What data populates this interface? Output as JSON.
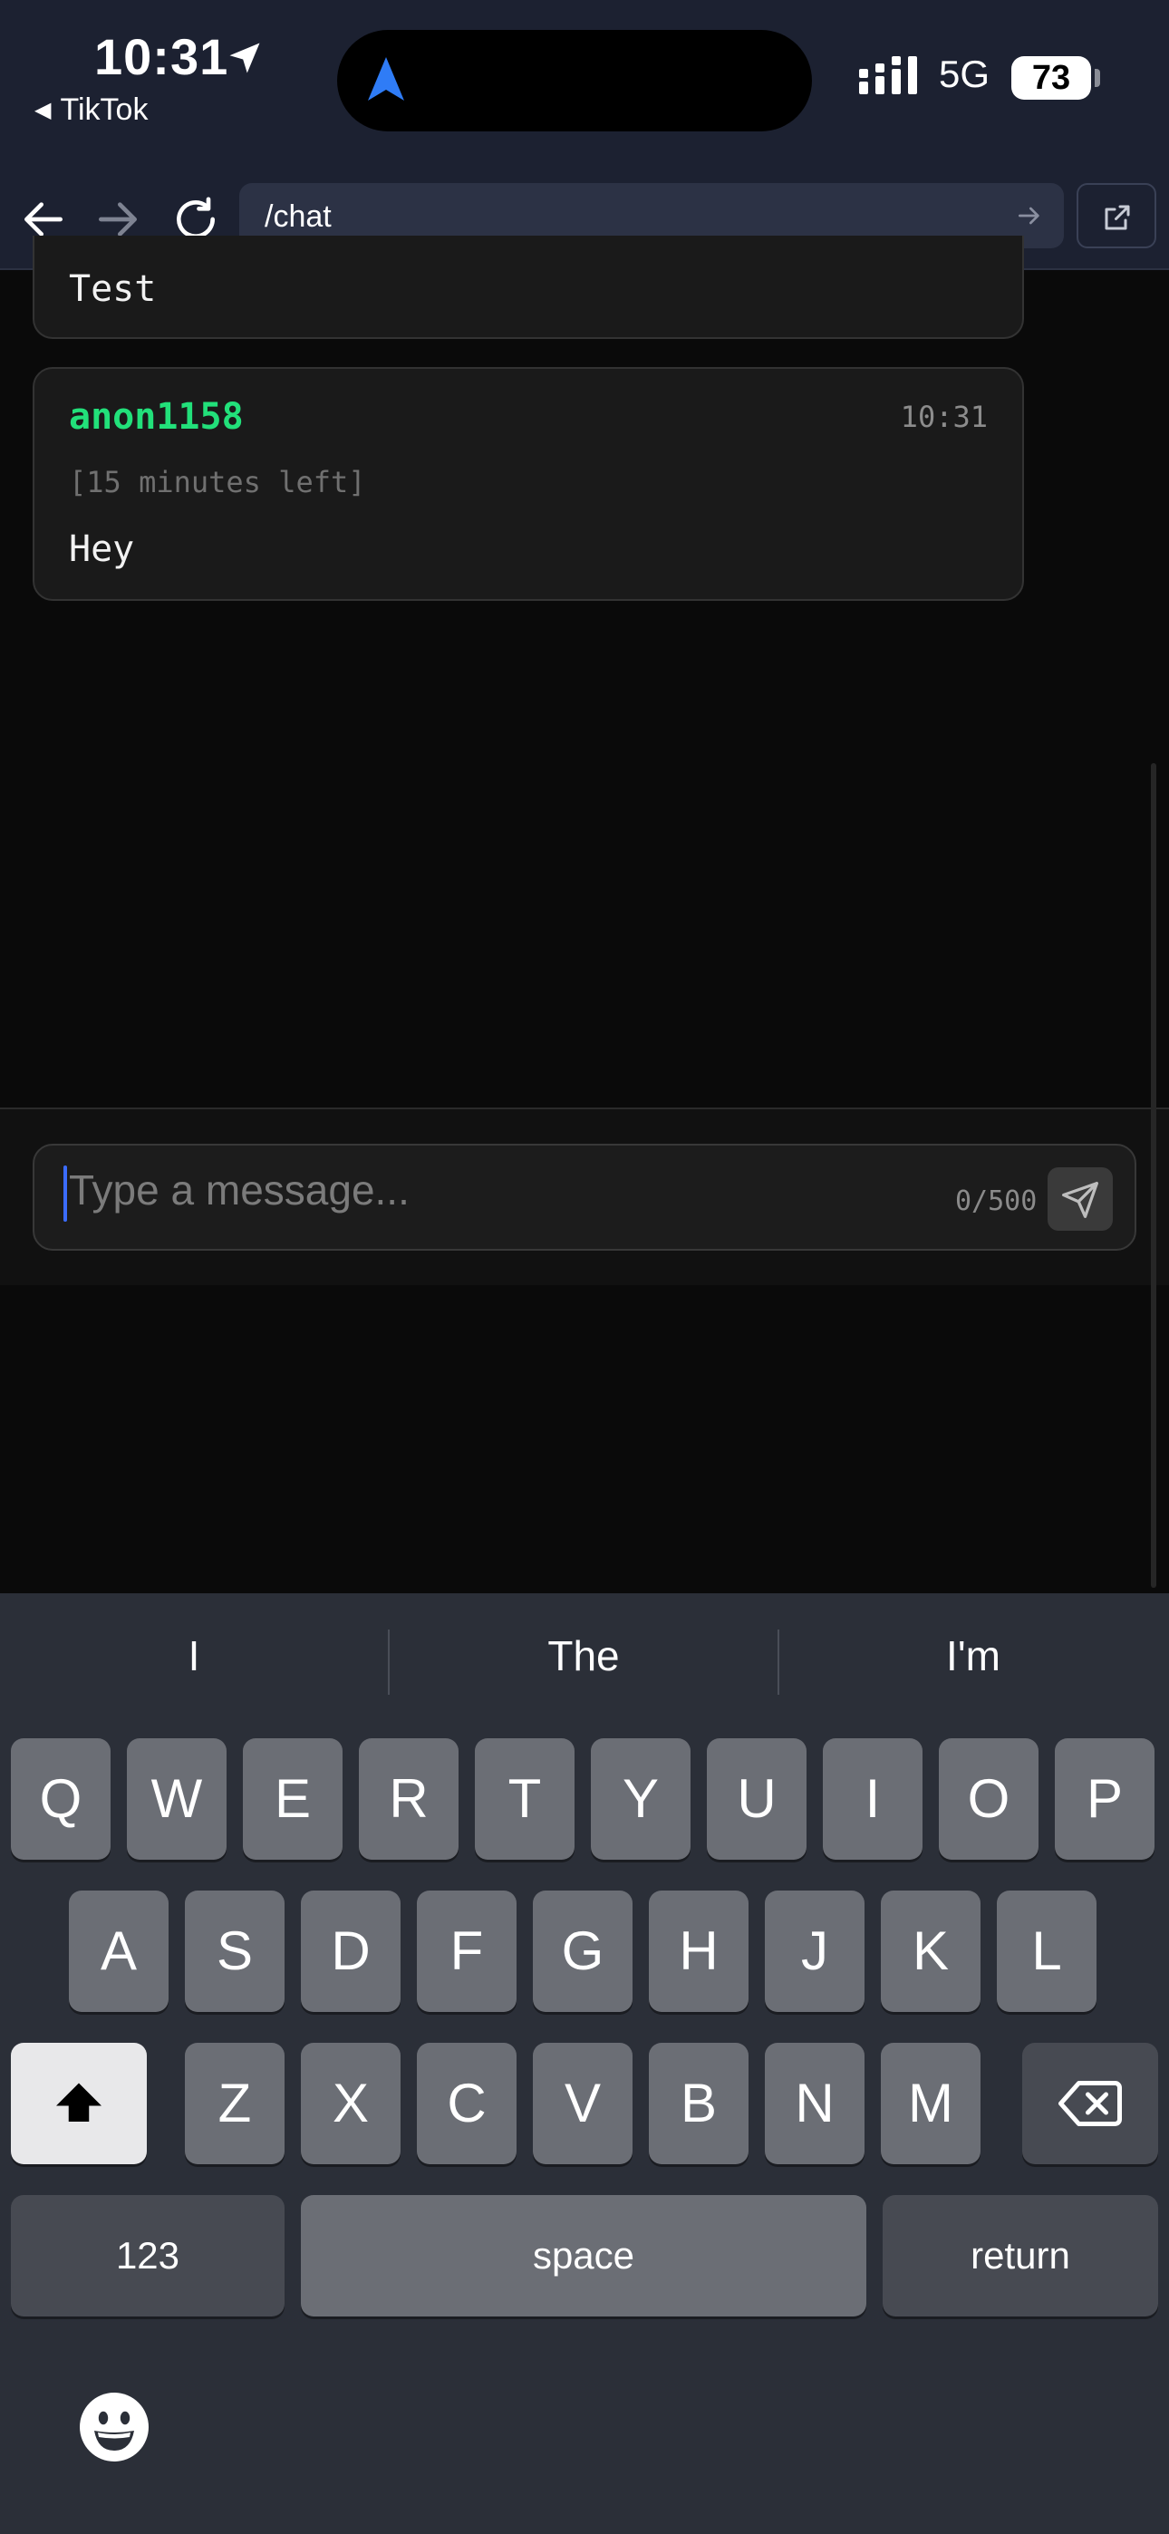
{
  "status_bar": {
    "time": "10:31",
    "back_app": "TikTok",
    "network": "5G",
    "battery": "73",
    "icons": [
      "location-arrow-icon",
      "navigation-icon",
      "signal-icon",
      "battery-icon"
    ]
  },
  "browser": {
    "url": "/chat",
    "icons": [
      "back-arrow-icon",
      "forward-arrow-icon",
      "reload-icon",
      "go-arrow-icon",
      "external-link-icon"
    ]
  },
  "chat": {
    "messages": [
      {
        "text": "Test"
      },
      {
        "user": "anon1158",
        "time": "10:31",
        "expiry": "[15 minutes left]",
        "text": "Hey"
      }
    ],
    "username_color": "#22e07a"
  },
  "composer": {
    "placeholder": "Type a message...",
    "char_count": "0/500",
    "send_icon": "send-icon"
  },
  "keyboard": {
    "suggestions": [
      "I",
      "The",
      "I'm"
    ],
    "row1": [
      "Q",
      "W",
      "E",
      "R",
      "T",
      "Y",
      "U",
      "I",
      "O",
      "P"
    ],
    "row2": [
      "A",
      "S",
      "D",
      "F",
      "G",
      "H",
      "J",
      "K",
      "L"
    ],
    "row3": [
      "Z",
      "X",
      "C",
      "V",
      "B",
      "N",
      "M"
    ],
    "numbers_label": "123",
    "space_label": "space",
    "return_label": "return",
    "icons": [
      "shift-icon",
      "delete-icon",
      "emoji-icon"
    ]
  }
}
